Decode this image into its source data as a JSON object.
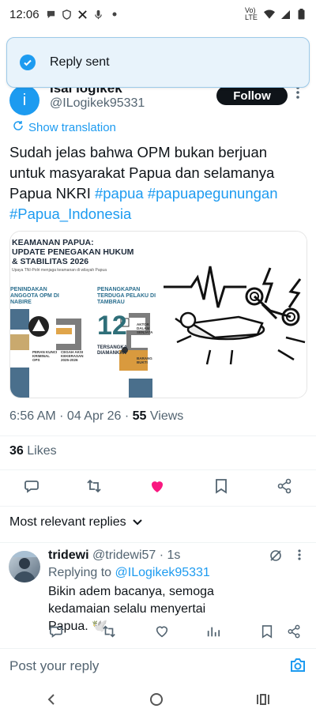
{
  "status_bar": {
    "time": "12:06",
    "network": "Vo) LTE"
  },
  "toast": {
    "message": "Reply sent"
  },
  "tweet": {
    "author_name": "Isal logikek",
    "author_handle": "@ILogikek95331",
    "avatar_letter": "i",
    "follow_label": "Follow",
    "show_translation": "Show translation",
    "text_plain": "Sudah jelas bahwa OPM bukan berjuan untuk masyarakat Papua dan selamanya Papua NKRI",
    "hashtags": [
      "#papua",
      "#papuapegunungan",
      "#Papua_Indonesia"
    ],
    "timestamp": "6:56 AM · 04 Apr 26 · ",
    "views_count": "55",
    "views_label": " Views",
    "likes_count": "36",
    "likes_label": " Likes"
  },
  "infographic": {
    "title_line1": "KEAMANAN PAPUA:",
    "title_line2": "UPDATE PENEGAKAN HUKUM",
    "title_line3": "& STABILITAS 2026",
    "intro": "Upaya TNI-Polri menjaga keamanan di wilayah Papua",
    "left_heading": "PENINDAKAN ANGGOTA OPM DI NABIRE",
    "right_heading": "PENANGKAPAN TERDUGA PELAKU DI TAMBRAU",
    "big_number": "12",
    "big_number_label": "TERSANGKA DIAMANKAN",
    "col1_a": "PERAN KUNCI KRIMINAL OPS",
    "col1_b": "CEGAH AKSI KEKERASAN 2025-2026",
    "col2_a": "AKTOR DALAM SENJATA",
    "col2_b": "BARANG BUKTI"
  },
  "sort": {
    "label": "Most relevant replies"
  },
  "reply": {
    "name": "tridewi",
    "handle_time": "@tridewi57 · 1s",
    "replying_prefix": "Replying to ",
    "replying_handle": "@ILogikek95331",
    "text": "Bikin adem bacanya, semoga kedamaian selalu menyertai Papua. 🕊️"
  },
  "compose": {
    "placeholder": "Post your reply"
  },
  "colors": {
    "accent": "#1d9bf0",
    "like": "#f91880",
    "text": "#0f1419",
    "muted": "#536471"
  }
}
